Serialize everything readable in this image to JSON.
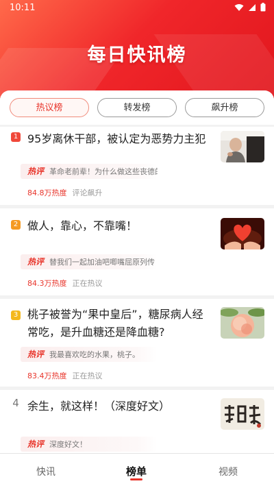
{
  "status_bar": {
    "time": "10:11",
    "icons": [
      "wifi-icon",
      "signal-icon",
      "battery-icon"
    ]
  },
  "header": {
    "title": "每日快讯榜"
  },
  "tabs": [
    {
      "label": "热议榜",
      "active": true
    },
    {
      "label": "转发榜",
      "active": false
    },
    {
      "label": "飙升榜",
      "active": false
    }
  ],
  "items": [
    {
      "rank": "1",
      "headline": "95岁离休干部，被认定为恶势力主犯",
      "comment_tag": "热评",
      "comment": "革命老前辈！为什么做这些丧德的事?",
      "heat": "84.8万热度",
      "status": "评论飙升"
    },
    {
      "rank": "2",
      "headline": "做人，靠心，不靠嘴！",
      "comment_tag": "热评",
      "comment": "替我们一起加油吧唧嘴屈原列传",
      "heat": "84.3万热度",
      "status": "正在热议"
    },
    {
      "rank": "3",
      "headline": "桃子被誉为“果中皇后”，糖尿病人经常吃，是升血糖还是降血糖?",
      "comment_tag": "热评",
      "comment": "我最喜欢吃的水果，桃子。",
      "heat": "83.4万热度",
      "status": "正在热议"
    },
    {
      "rank": "4",
      "headline": "余生，就这样！（深度好文）",
      "comment_tag": "热评",
      "comment": "深度好文！"
    }
  ],
  "bottom_nav": [
    {
      "label": "快讯",
      "active": false
    },
    {
      "label": "榜单",
      "active": true
    },
    {
      "label": "视频",
      "active": false
    }
  ],
  "colors": {
    "accent": "#e8342a",
    "header_red": "#f0262a"
  }
}
